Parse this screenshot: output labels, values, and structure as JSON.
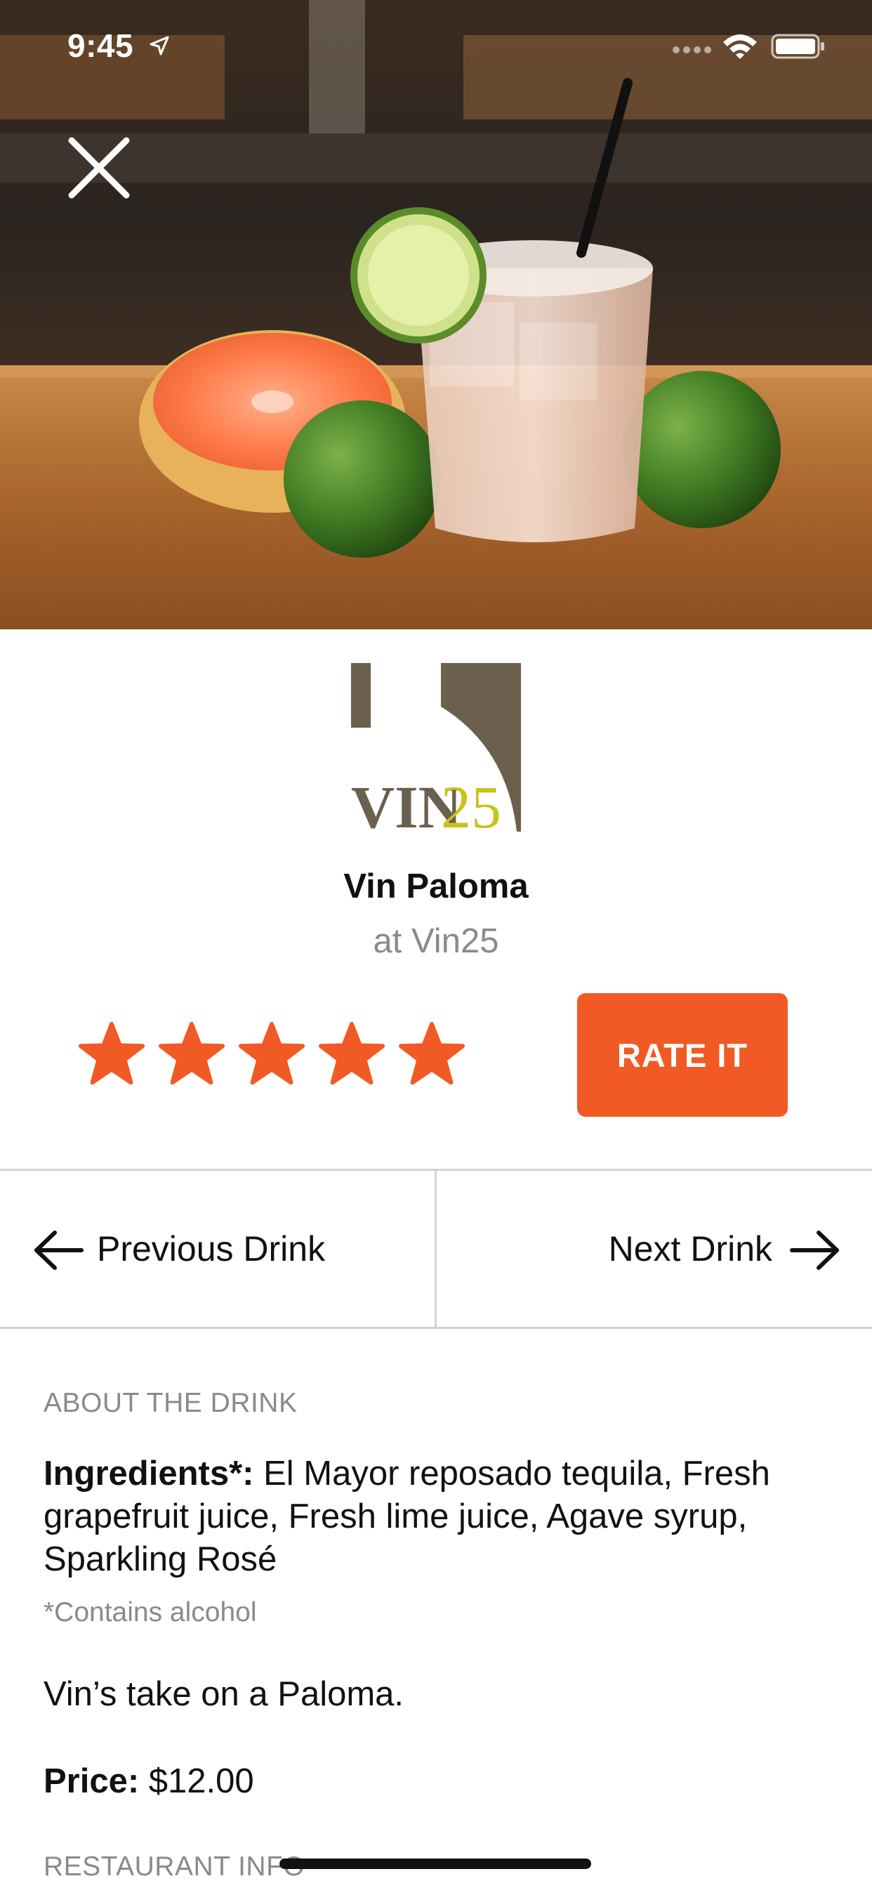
{
  "status_bar": {
    "time": "9:45"
  },
  "drink": {
    "name": "Vin Paloma",
    "venue": "at Vin25",
    "rating": 5,
    "rating_max": 5
  },
  "logo": {
    "text": "VIN25"
  },
  "actions": {
    "rate_label": "RATE IT"
  },
  "nav": {
    "previous_label": "Previous Drink",
    "next_label": "Next Drink"
  },
  "about": {
    "heading": "ABOUT THE DRINK",
    "ingredients_label": "Ingredients*:",
    "ingredients_text": " El Mayor reposado tequila, Fresh grapefruit juice, Fresh lime juice, Agave syrup, Sparkling Rosé",
    "alcohol_note": "*Contains alcohol",
    "description": "Vin’s take on a Paloma.",
    "price_label": "Price:",
    "price_value": " $12.00"
  },
  "restaurant": {
    "heading": "RESTAURANT INFO"
  },
  "colors": {
    "accent": "#f15a24",
    "logo_brown": "#6b5f4d",
    "logo_yellow": "#c9c21b"
  }
}
